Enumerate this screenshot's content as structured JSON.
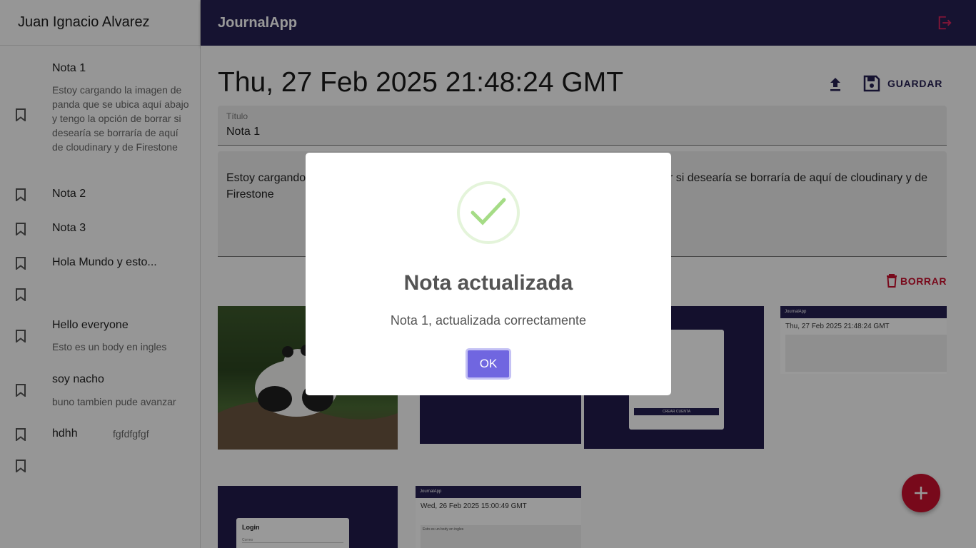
{
  "sidebar": {
    "user_name": "Juan Ignacio Alvarez",
    "notes": [
      {
        "title": "Nota 1",
        "body": "Estoy cargando la imagen de panda que se ubica aquí abajo y tengo la opción de borrar si desearía se borraría de aquí de cloudinary y de Firestone"
      },
      {
        "title": "Nota 2",
        "body": ""
      },
      {
        "title": "Nota 3",
        "body": ""
      },
      {
        "title": "Hola Mundo y esto...",
        "body": ""
      },
      {
        "title": "",
        "body": ""
      },
      {
        "title": "Hello everyone",
        "body": "Esto es un body en ingles"
      },
      {
        "title": "soy nacho",
        "body": "buno tambien pude avanzar"
      },
      {
        "title": "hdhh",
        "body": "fgfdfgfgf"
      },
      {
        "title": "",
        "body": ""
      }
    ]
  },
  "topbar": {
    "app_title": "JournalApp",
    "logout_icon": "logout-icon"
  },
  "note_view": {
    "date": "Thu, 27 Feb 2025 21:48:24 GMT",
    "save_label": "GUARDAR",
    "title_label": "Título",
    "title_value": "Nota 1",
    "body_value": "Estoy cargando la imagen de panda que se ubica aquí abajo y tengo la opción de borrar si desearía se borraría de aquí de cloudinary y de Firestone",
    "delete_label": "BORRAR",
    "thumb_texts": {
      "shot1_date": "Thu, 27 Feb 2025 21:48:24 GMT",
      "shot1_app": "JournalApp",
      "shot2_app": "JournalApp",
      "shot2_date": "Wed, 26 Feb 2025 15:00:49 GMT",
      "shot2_body": "Esto es un body en ingles",
      "login_title": "Login",
      "login_field": "Correo",
      "register_btn": "CREAR CUENTA"
    }
  },
  "dialog": {
    "title": "Nota actualizada",
    "text": "Nota 1, actualizada correctamente",
    "ok_label": "OK"
  },
  "colors": {
    "primary": "#262052",
    "error": "#c8102e",
    "confirm": "#7066e0",
    "success": "#a5dc86"
  }
}
